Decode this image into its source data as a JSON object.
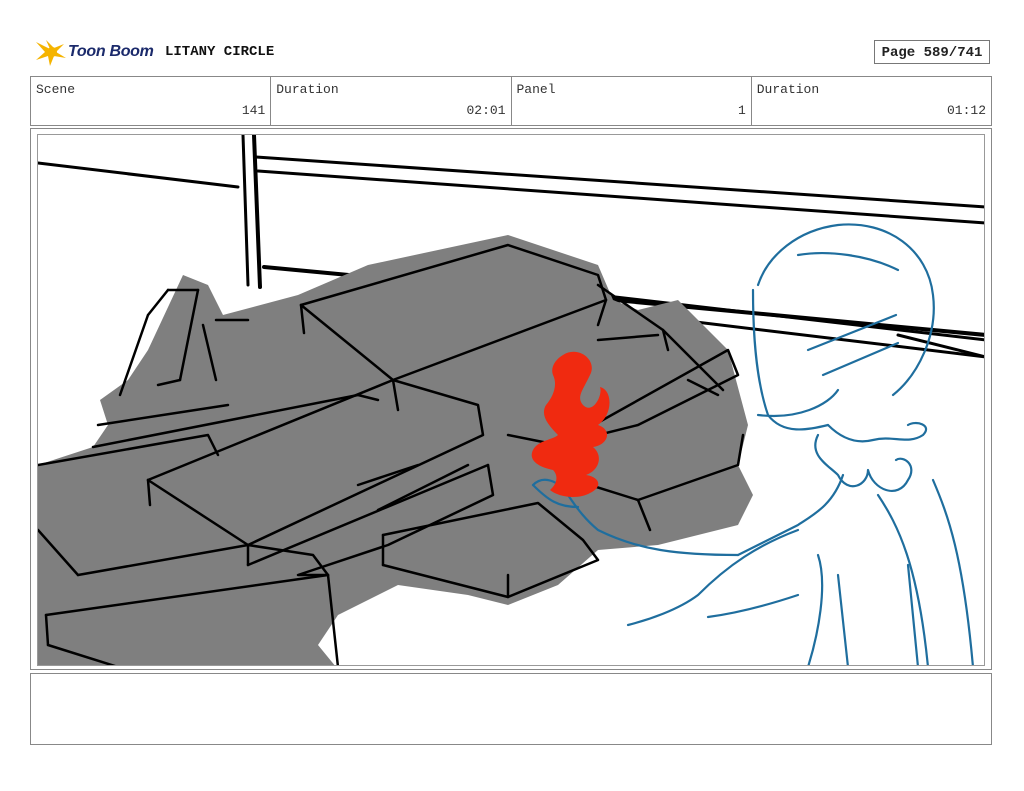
{
  "header": {
    "brand": "Toon Boom",
    "project_title": "LITANY CIRCLE",
    "page_label": "Page 589/741"
  },
  "info": {
    "scene_label": "Scene",
    "scene_value": "141",
    "scene_duration_label": "Duration",
    "scene_duration_value": "02:01",
    "panel_label": "Panel",
    "panel_value": "1",
    "panel_duration_label": "Duration",
    "panel_duration_value": "01:12"
  },
  "colors": {
    "logo_yellow": "#f5b400",
    "logo_text": "#1b2a6b",
    "rubble_gray": "#7f7f7f",
    "character_blue": "#1f6e9e",
    "flame_red": "#f02a10"
  }
}
